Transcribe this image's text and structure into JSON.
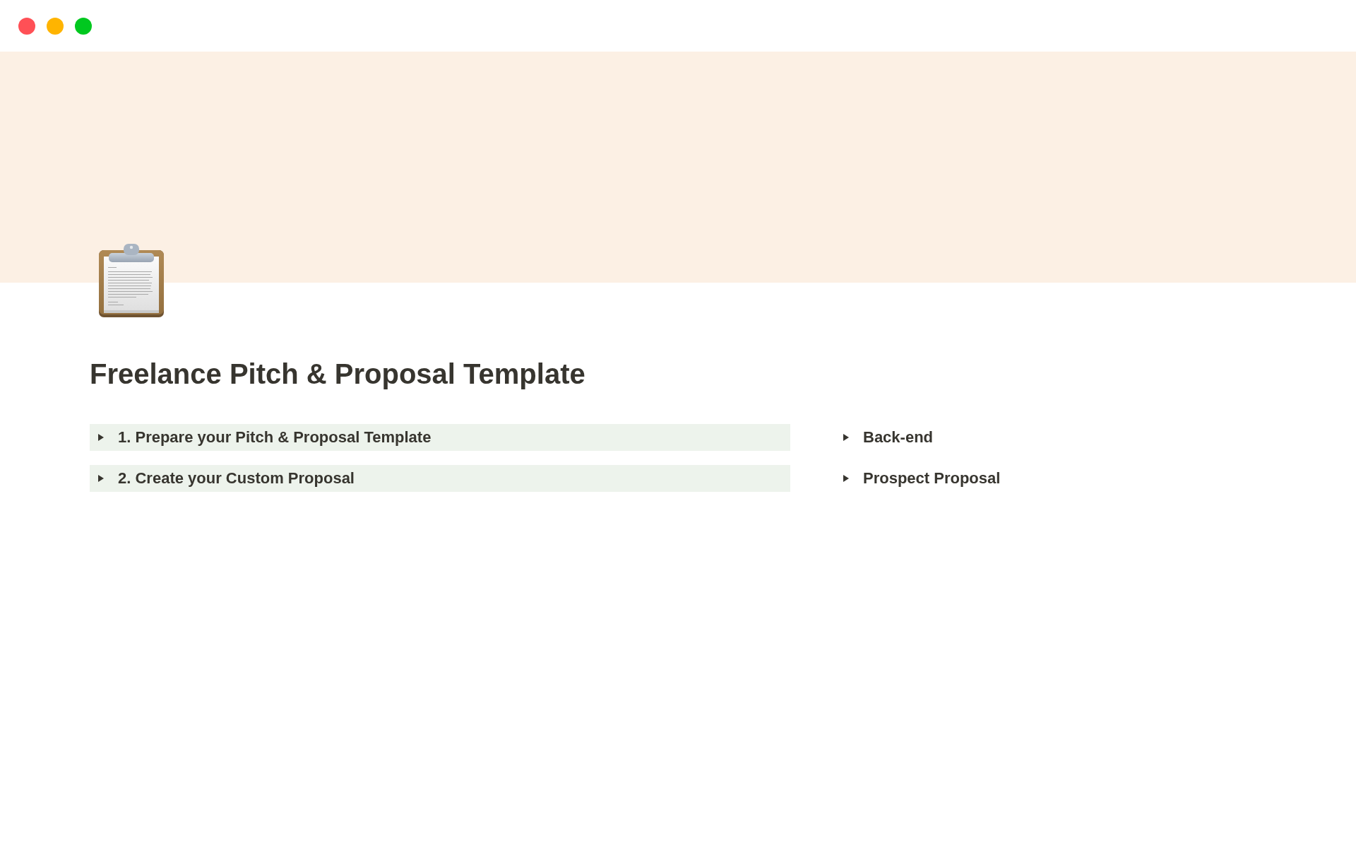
{
  "window": {
    "controls": [
      {
        "color": "#ff5056"
      },
      {
        "color": "#ffb400"
      },
      {
        "color": "#00c81f"
      }
    ]
  },
  "page": {
    "title": "Freelance Pitch & Proposal Template"
  },
  "columns": [
    {
      "toggles": [
        {
          "label": "1. Prepare your Pitch & Proposal Template",
          "expanded": false,
          "highlighted": true
        },
        {
          "label": "2. Create your Custom Proposal",
          "expanded": false,
          "highlighted": true
        }
      ]
    },
    {
      "toggles": [
        {
          "label": "Back-end",
          "expanded": false,
          "highlighted": false
        },
        {
          "label": "Prospect Proposal",
          "expanded": false,
          "highlighted": false
        }
      ]
    }
  ]
}
